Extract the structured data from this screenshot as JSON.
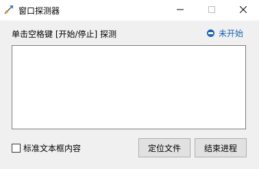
{
  "window": {
    "title": "窗口探测器",
    "icon": "crosshair-icon"
  },
  "controls": {
    "minimize": "minimize-icon",
    "maximize": "maximize-icon",
    "close": "close-icon"
  },
  "main": {
    "hint": "单击空格键 [开始/停止] 探测",
    "status_text": "未开始",
    "status_color": "#1565c0",
    "content": ""
  },
  "footer": {
    "checkbox_label": "标准文本框内容",
    "checkbox_checked": false,
    "locate_button": "定位文件",
    "end_button": "结束进程"
  }
}
